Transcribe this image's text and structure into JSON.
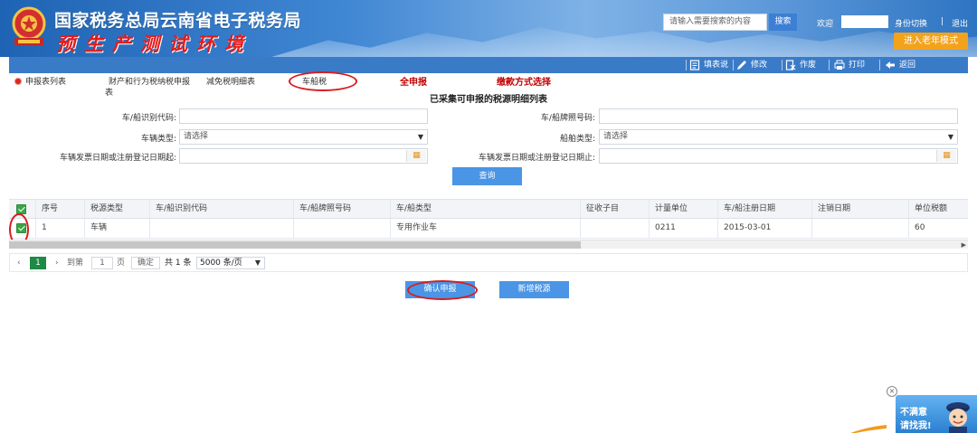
{
  "header": {
    "title": "国家税务总局云南省电子税务局",
    "subtitle": "预生产测试环境",
    "search_placeholder": "请输入需要搜索的内容",
    "search_button": "搜索",
    "welcome": "欢迎",
    "switch_identity": "身份切换",
    "separator": "|",
    "logout": "退出",
    "elder_mode": "进入老年模式"
  },
  "toolbar": {
    "fill_guide": "填表说",
    "edit": "修改",
    "void": "作废",
    "print": "打印",
    "back": "返回"
  },
  "tabs": {
    "declaration_list": "申报表列表",
    "property_tax_line1": "财产和行为税纳税申报",
    "property_tax_line2": "表",
    "reduction_detail": "减免税明细表",
    "vehicle_tax": "车船税",
    "full_declare": "全申报",
    "payment_method": "缴款方式选择"
  },
  "page_title": "已采集可申报的税源明细列表",
  "form": {
    "vin_label": "车/船识别代码:",
    "vin_value": "",
    "plate_label": "车/船牌照号码:",
    "plate_value": "",
    "vehicle_type_label": "车辆类型:",
    "vehicle_type_value": "请选择",
    "ship_type_label": "船舶类型:",
    "ship_type_value": "请选择",
    "date_start_label": "车辆发票日期或注册登记日期起:",
    "date_start_value": "",
    "date_end_label": "车辆发票日期或注册登记日期止:",
    "date_end_value": "",
    "query_button": "查询"
  },
  "table": {
    "headers": [
      "序号",
      "税源类型",
      "车/船识别代码",
      "车/船牌照号码",
      "车/船类型",
      "征收子目",
      "计量单位",
      "车/船注册日期",
      "注销日期",
      "单位税额"
    ],
    "rows": [
      [
        "1",
        "车辆",
        "",
        "",
        "专用作业车",
        "",
        "0211",
        "2015-03-01",
        "",
        "60"
      ]
    ]
  },
  "pager": {
    "current_page": "1",
    "goto_label": "到第",
    "goto_value": "1",
    "page_unit": "页",
    "confirm": "确定",
    "total": "共 1 条",
    "page_size": "5000 条/页"
  },
  "actions": {
    "confirm_declare": "确认申报",
    "add_tax_source": "新增税源"
  },
  "widget": {
    "line1": "不满意",
    "line2": "请找我!"
  },
  "colors": {
    "header_blue": "#3f86d3",
    "toolbar_blue": "#3a7bc8",
    "button_blue": "#4a95e6",
    "elder_orange": "#f3a21c",
    "tab_red": "#c40000",
    "checkbox_green": "#3aa54a",
    "pager_green": "#1d8a46",
    "annotation_red": "#d91c1c"
  }
}
